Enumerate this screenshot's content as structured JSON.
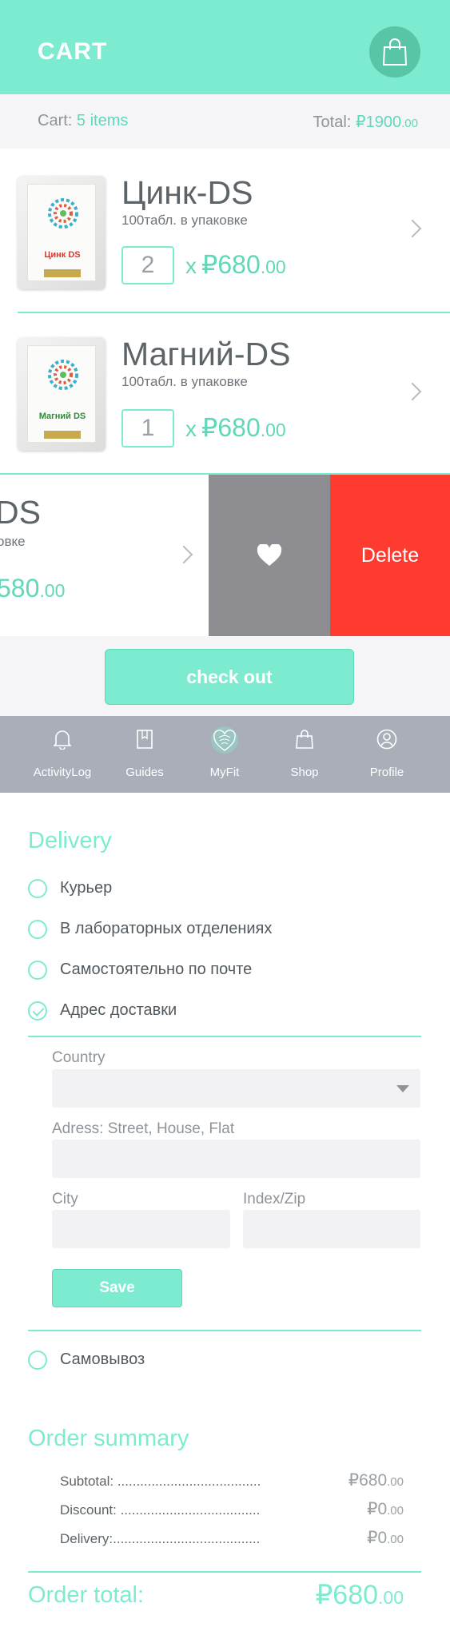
{
  "header": {
    "title": "CART",
    "cart_icon": "shopping-bag-icon"
  },
  "summary": {
    "cart_label": "Cart:",
    "cart_count": "5 items",
    "total_label": "Total:",
    "total_value": "₽1900",
    "total_cents": ".00"
  },
  "items": [
    {
      "name": "Цинк-DS",
      "desc": "100табл. в упаковке",
      "qty": "2",
      "x": "x",
      "price": "₽680",
      "cents": ".00",
      "box_label": "Цинк DS",
      "box_color": "#d83a2a"
    },
    {
      "name": "Магний-DS",
      "desc": "100табл. в упаковке",
      "qty": "1",
      "x": "x",
      "price": "₽680",
      "cents": ".00",
      "box_label": "Магний DS",
      "box_color": "#2e8b3a"
    }
  ],
  "swiped_item": {
    "name_fragment": "DS",
    "desc_fragment": "овке",
    "price_fragment": "580",
    "cents": ".00",
    "delete_label": "Delete"
  },
  "checkout": {
    "label": "check out"
  },
  "tabbar": [
    {
      "label": "ActivityLog",
      "icon": "bell-icon"
    },
    {
      "label": "Guides",
      "icon": "book-icon"
    },
    {
      "label": "MyFit",
      "icon": "heart-fingerprint-icon"
    },
    {
      "label": "Shop",
      "icon": "shopping-bag-icon"
    },
    {
      "label": "Profile",
      "icon": "user-circle-icon"
    }
  ],
  "delivery": {
    "title": "Delivery",
    "options": [
      {
        "label": "Курьер",
        "checked": false
      },
      {
        "label": "В лабораторных отделениях",
        "checked": false
      },
      {
        "label": "Самостоятельно по почте",
        "checked": false
      },
      {
        "label": "Адрес доставки",
        "checked": true
      }
    ],
    "form": {
      "country_label": "Country",
      "country_value": "",
      "address_label": "Adress: Street, House, Flat",
      "address_value": "",
      "city_label": "City",
      "city_value": "",
      "zip_label": "Index/Zip",
      "zip_value": "",
      "save_label": "Save"
    },
    "pickup_option": {
      "label": "Самовывоз",
      "checked": false
    }
  },
  "order_summary": {
    "title": "Order summary",
    "rows": [
      {
        "label": "Subtotal: ......................................",
        "value": "₽680",
        "cents": ".00"
      },
      {
        "label": "Discount: .....................................",
        "value": "₽0",
        "cents": ".00"
      },
      {
        "label": "Delivery:.......................................",
        "value": "₽0",
        "cents": ".00"
      }
    ],
    "total_label": "Order total:",
    "total_value": "₽680",
    "total_cents": ".00"
  },
  "colors": {
    "accent": "#7debd0",
    "accent_dark": "#58c6a6",
    "delete": "#ff3b30",
    "favorite": "#8e8d92",
    "tabbar": "#a9aeb9"
  }
}
